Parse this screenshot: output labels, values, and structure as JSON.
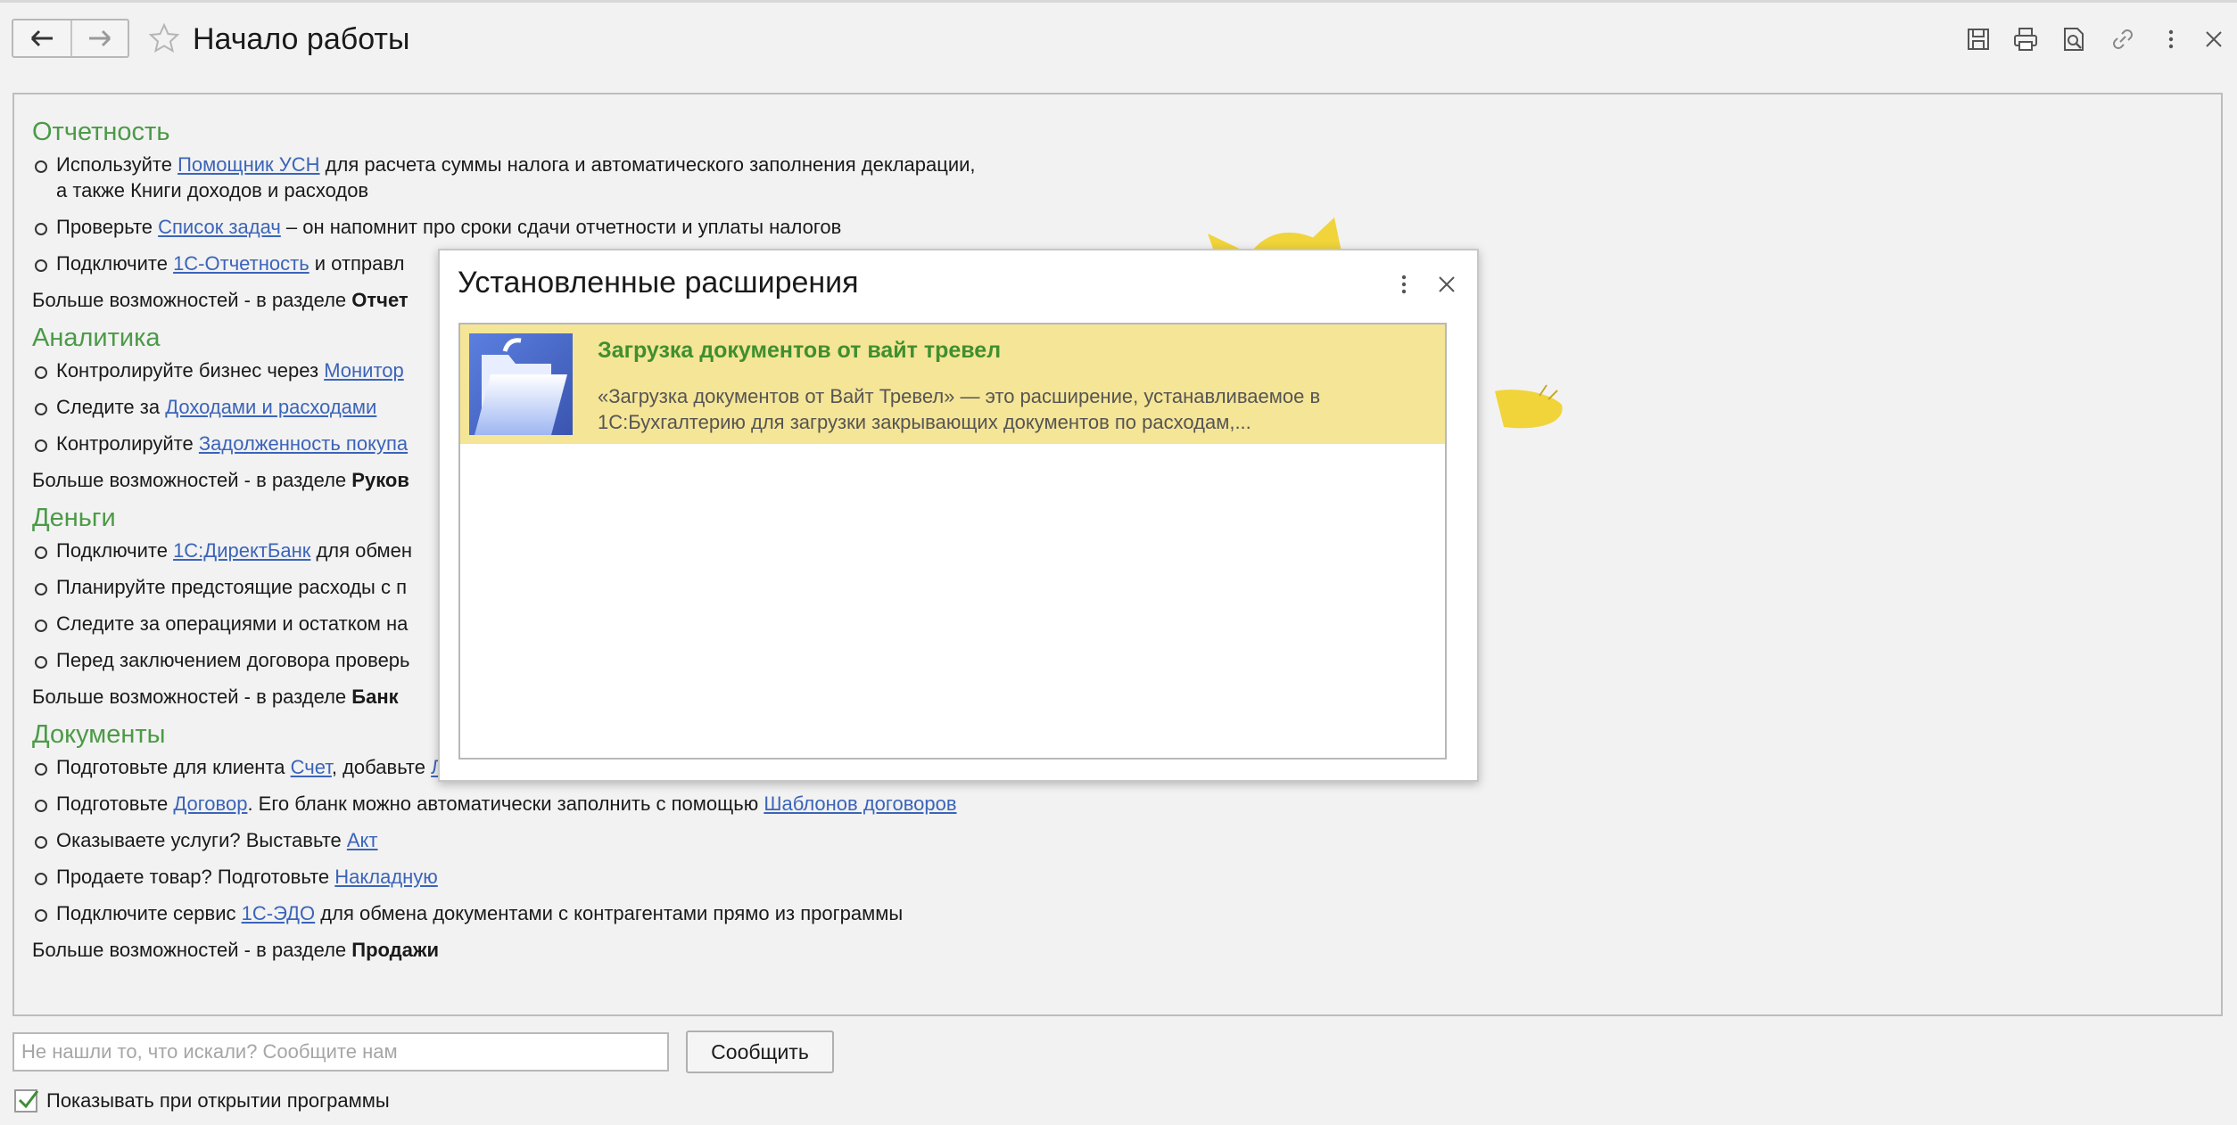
{
  "header": {
    "title": "Начало работы",
    "icons": [
      "back-arrow-icon",
      "forward-arrow-icon",
      "star-icon",
      "save-icon",
      "print-icon",
      "preview-icon",
      "link-icon",
      "more-icon",
      "close-icon"
    ]
  },
  "content": {
    "sections": [
      {
        "title": "Отчетность",
        "items": [
          {
            "parts": [
              {
                "t": "Используйте "
              },
              {
                "t": "Помощник УСН",
                "link": true
              },
              {
                "t": " для расчета суммы налога и автоматического заполнения декларации,"
              }
            ],
            "line2": "а также Книги доходов и расходов"
          },
          {
            "parts": [
              {
                "t": "Проверьте "
              },
              {
                "t": "Список задач",
                "link": true
              },
              {
                "t": " – он напомнит про сроки сдачи отчетности и уплаты налогов"
              }
            ]
          },
          {
            "parts": [
              {
                "t": "Подключите "
              },
              {
                "t": "1С-Отчетность",
                "link": true
              },
              {
                "t": " и отправл"
              }
            ]
          }
        ],
        "more_text": "Больше возможностей - в разделе ",
        "more_bold": "Отчет"
      },
      {
        "title": "Аналитика",
        "items": [
          {
            "parts": [
              {
                "t": "Контролируйте бизнес через "
              },
              {
                "t": "Монитор",
                "link": true
              }
            ]
          },
          {
            "parts": [
              {
                "t": "Следите за "
              },
              {
                "t": "Доходами и расходами",
                "link": true
              }
            ]
          },
          {
            "parts": [
              {
                "t": "Контролируйте "
              },
              {
                "t": "Задолженность покупа",
                "link": true
              }
            ]
          }
        ],
        "more_text": "Больше возможностей - в разделе ",
        "more_bold": "Руков"
      },
      {
        "title": "Деньги",
        "items": [
          {
            "parts": [
              {
                "t": "Подключите "
              },
              {
                "t": "1С:ДиректБанк",
                "link": true
              },
              {
                "t": " для обмен"
              }
            ]
          },
          {
            "parts": [
              {
                "t": "Планируйте предстоящие расходы с п"
              }
            ]
          },
          {
            "parts": [
              {
                "t": "Следите за операциями и остатком на"
              }
            ]
          },
          {
            "parts": [
              {
                "t": "Перед заключением договора проверь"
              }
            ]
          }
        ],
        "more_text": "Больше возможностей - в разделе ",
        "more_bold": "Банк"
      },
      {
        "title": "Документы",
        "items": [
          {
            "parts": [
              {
                "t": "Подготовьте для клиента "
              },
              {
                "t": "Счет",
                "link": true
              },
              {
                "t": ", добавьте "
              },
              {
                "t": "Логотип и печать",
                "link": true
              }
            ]
          },
          {
            "parts": [
              {
                "t": "Подготовьте "
              },
              {
                "t": "Договор",
                "link": true
              },
              {
                "t": ". Его бланк можно автоматически заполнить с помощью "
              },
              {
                "t": "Шаблонов договоров",
                "link": true
              }
            ]
          },
          {
            "parts": [
              {
                "t": "Оказываете услуги? Выставьте "
              },
              {
                "t": "Акт",
                "link": true
              }
            ]
          },
          {
            "parts": [
              {
                "t": "Продаете товар? Подготовьте "
              },
              {
                "t": "Накладную",
                "link": true
              }
            ]
          },
          {
            "parts": [
              {
                "t": "Подключите сервис "
              },
              {
                "t": "1С-ЭДО",
                "link": true
              },
              {
                "t": " для обмена документами с контрагентами прямо из программы"
              }
            ]
          }
        ],
        "more_text": "Больше возможностей - в разделе ",
        "more_bold": "Продажи"
      }
    ]
  },
  "modal": {
    "title": "Установленные расширения",
    "extension": {
      "name": "Загрузка документов от вайт тревел",
      "description_line1": "«Загрузка документов от Вайт Тревел» — это расширение, устанавливаемое в",
      "description_line2": "1С:Бухгалтерию для загрузки закрывающих документов по расходам,..."
    }
  },
  "footer": {
    "feedback_placeholder": "Не нашли то, что искали? Сообщите нам",
    "report_button": "Сообщить",
    "show_on_open_label": "Показывать при открытии программы",
    "show_on_open_checked": true
  },
  "colors": {
    "section_title": "#4c9a47",
    "link": "#3b64b9",
    "selected_row": "#f5e596",
    "extension_name": "#3f8f2f"
  }
}
